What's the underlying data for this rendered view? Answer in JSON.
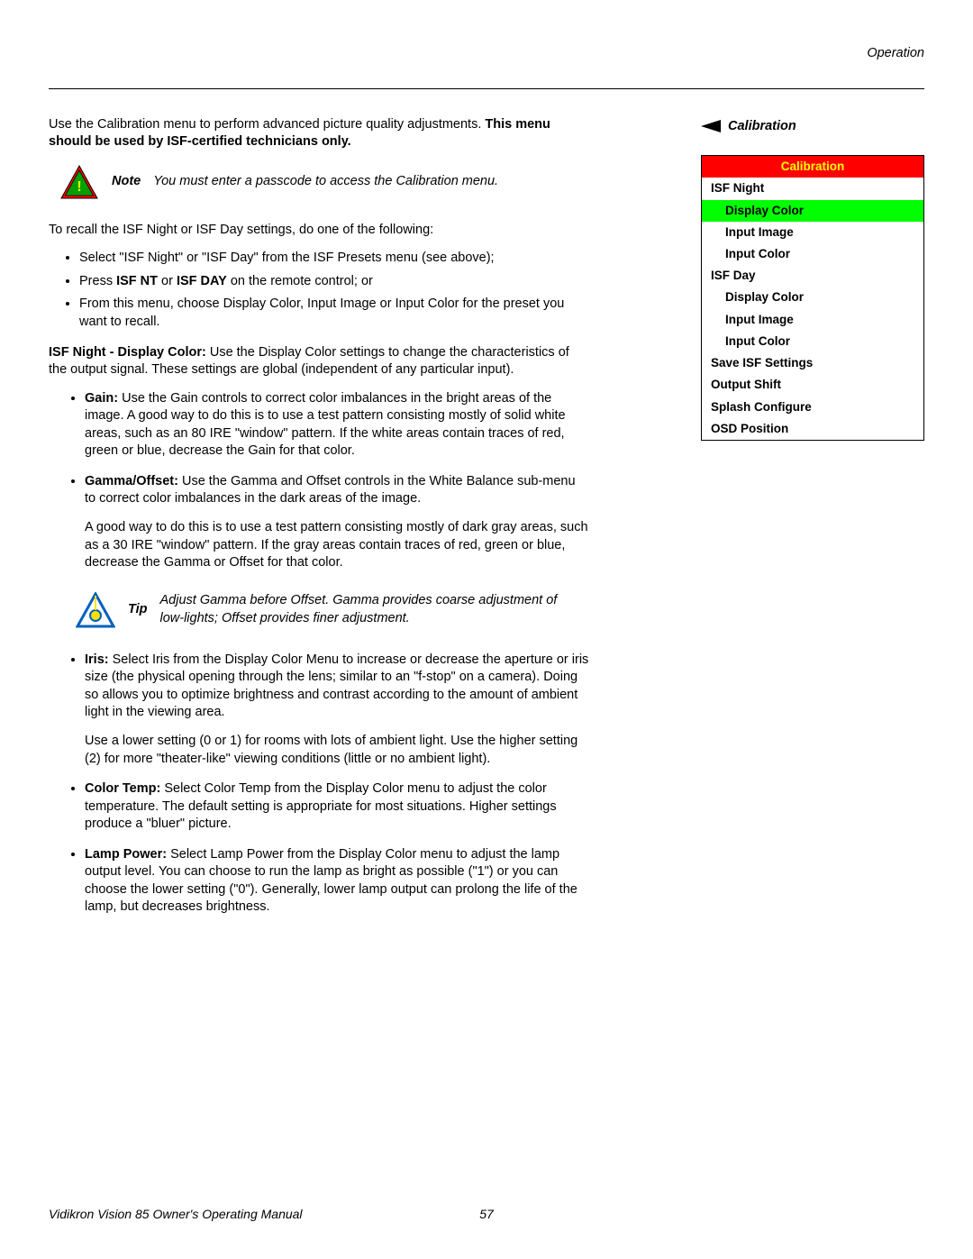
{
  "header": {
    "chapter": "Operation"
  },
  "side": {
    "heading": "Calibration",
    "menu": {
      "title": "Calibration",
      "rows": [
        {
          "text": "ISF Night",
          "class": "top"
        },
        {
          "text": "Display Color",
          "class": "sub sel"
        },
        {
          "text": "Input Image",
          "class": "sub"
        },
        {
          "text": "Input Color",
          "class": "sub"
        },
        {
          "text": "ISF Day",
          "class": "top"
        },
        {
          "text": "Display Color",
          "class": "sub"
        },
        {
          "text": "Input Image",
          "class": "sub"
        },
        {
          "text": "Input Color",
          "class": "sub"
        },
        {
          "text": "Save ISF Settings",
          "class": "top"
        },
        {
          "text": "Output Shift",
          "class": "top"
        },
        {
          "text": "Splash Configure",
          "class": "top"
        },
        {
          "text": "OSD Position",
          "class": "top"
        }
      ]
    }
  },
  "intro": {
    "p1a": "Use the Calibration menu to perform advanced picture quality adjustments. ",
    "p1b": "This menu should be used by ISF-certified technicians only."
  },
  "note": {
    "label": "Note",
    "text": "You must enter a passcode to access the Calibration menu."
  },
  "recall": {
    "intro": "To recall the ISF Night or ISF Day settings, do one of the following:",
    "li1": "Select \"ISF Night\" or \"ISF Day\" from the ISF Presets menu (see above);",
    "li2a": "Press ",
    "li2b": "ISF NT",
    "li2c": " or ",
    "li2d": "ISF DAY",
    "li2e": " on the remote control; or",
    "li3": "From this menu, choose Display Color, Input Image or Input Color for the preset you want to recall."
  },
  "display_color": {
    "lead_bold": "ISF Night - Display Color: ",
    "lead_rest": "Use the Display Color settings to change the characteristics of the output signal. These settings are global (independent of any particular input).",
    "gain": {
      "label": "Gain: ",
      "text": "Use the Gain controls to correct color imbalances in the bright areas of the image. A good way to do this is to use a test pattern consisting mostly of solid white areas, such as an 80 IRE \"window\" pattern. If the white areas contain traces of red, green or blue, decrease the Gain for that color."
    },
    "gamma": {
      "label": "Gamma/Offset: ",
      "text": "Use the Gamma and Offset controls in the White Balance sub-menu to correct color imbalances in the dark areas of the image.",
      "p2": "A good way to do this is to use a test pattern consisting mostly of dark gray areas, such as a 30 IRE \"window\" pattern. If the gray areas contain traces of red, green or blue, decrease the Gamma or Offset for that color."
    }
  },
  "tip": {
    "label": "Tip",
    "text": "Adjust Gamma before Offset. Gamma provides coarse adjustment of low-lights; Offset provides finer adjustment."
  },
  "more": {
    "iris": {
      "label": "Iris: ",
      "text": "Select Iris from the Display Color Menu to increase or decrease the aperture or iris size (the physical opening through the lens; similar to an \"f-stop\" on a camera). Doing so allows you to optimize brightness and contrast according to the amount of ambient light in the viewing area.",
      "p2": "Use a lower setting (0 or 1) for rooms with lots of ambient light. Use the higher setting (2) for more \"theater-like\" viewing conditions (little or no ambient light)."
    },
    "color_temp": {
      "label": "Color Temp: ",
      "text": "Select Color Temp from the Display Color menu to adjust the color temperature. The default setting is appropriate for most situations. Higher settings produce a \"bluer\" picture."
    },
    "lamp": {
      "label": "Lamp Power:  ",
      "text": "Select Lamp Power from the Display Color menu to adjust the lamp output level. You can choose to run the lamp as bright as possible (\"1\") or you can choose the lower setting (\"0\"). Generally, lower lamp output can prolong the life of the lamp, but decreases brightness."
    }
  },
  "footer": {
    "title": "Vidikron Vision 85 Owner's Operating Manual",
    "page": "57"
  }
}
